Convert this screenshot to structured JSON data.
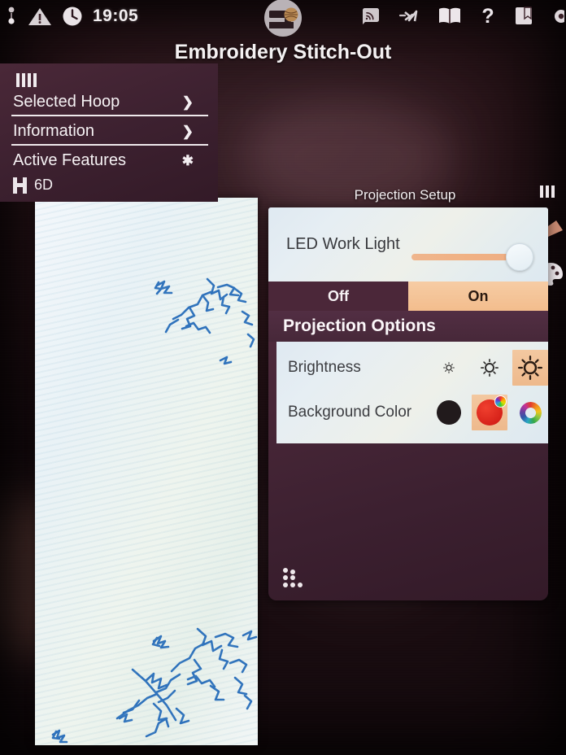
{
  "statusbar": {
    "clock": "19:05",
    "left_icons": [
      "pendant-icon",
      "warning-triangle-icon",
      "clock-icon"
    ],
    "center_icon": "sewing-machine-icon",
    "right_icons": [
      "wifi-signal-icon",
      "thread-path-icon",
      "manual-book-icon",
      "help-question-icon",
      "bookmark-icon",
      "gear-icon"
    ]
  },
  "header": {
    "title": "Embroidery Stitch-Out"
  },
  "left_menu": {
    "hoop_indicator": "hoop-bars-icon",
    "rows": [
      {
        "label": "Selected Hoop",
        "chevron": "chevron-right"
      },
      {
        "label": "Information",
        "chevron": "chevron-right"
      },
      {
        "label": "Active Features",
        "chevron": "chevron-down"
      }
    ],
    "feature": {
      "icon": "hoop-h-icon",
      "label": "6D"
    }
  },
  "right_strip": {
    "icons": [
      "hoop-bars-icon",
      "presser-foot-icon",
      "thread-palette-icon"
    ]
  },
  "dialog": {
    "title": "Projection Setup",
    "led": {
      "label": "LED Work Light",
      "slider_value": 100,
      "slider_name": "led-brightness-slider"
    },
    "toggle": {
      "off_label": "Off",
      "on_label": "On",
      "selected": "On"
    },
    "options_header": "Projection Options",
    "brightness": {
      "label": "Brightness",
      "levels": [
        "low",
        "medium",
        "high"
      ],
      "selected_index": 2
    },
    "background_color": {
      "label": "Background Color",
      "swatches": [
        "black-swatch",
        "red-swatch",
        "color-wheel-swatch"
      ],
      "selected_index": 1
    },
    "drag_handle": "drag-handle-dots"
  },
  "canvas": {
    "name": "embroidery-design-canvas",
    "stitch_color": "#2f72bc"
  },
  "colors": {
    "accent_orange": "#f0b184",
    "panel_purple": "#4a2839",
    "dialog_light": "#e6eef3",
    "stitch_blue": "#2f72bc",
    "text_light": "#f4f1f2"
  }
}
